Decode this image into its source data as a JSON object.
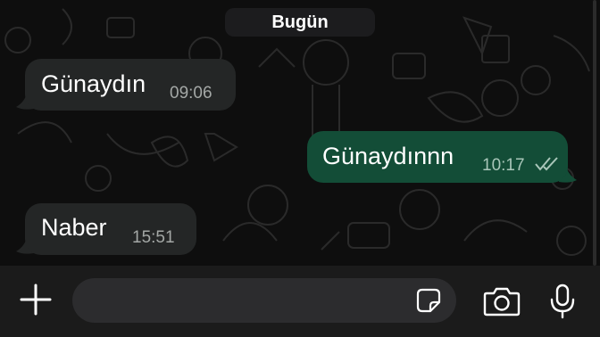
{
  "chat": {
    "date_label": "Bugün",
    "messages": [
      {
        "direction": "incoming",
        "text": "Günaydın",
        "time": "09:06"
      },
      {
        "direction": "outgoing",
        "text": "Günaydınnn",
        "time": "10:17",
        "status": "read"
      },
      {
        "direction": "incoming",
        "text": "Naber",
        "time": "15:51"
      }
    ]
  },
  "input_bar": {
    "message_placeholder": "",
    "icons": [
      "plus-icon",
      "sticker-icon",
      "camera-icon",
      "microphone-icon"
    ]
  },
  "colors": {
    "incoming_bubble": "#242626",
    "outgoing_bubble": "#134d37",
    "read_ticks": "#a9c6b9"
  }
}
